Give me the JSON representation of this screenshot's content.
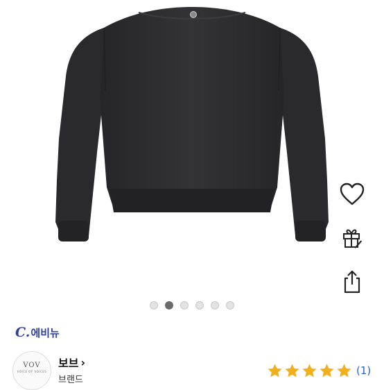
{
  "seller": {
    "logo_mark": "C.",
    "name": "에비뉴"
  },
  "brand": {
    "logo_text": "VOV",
    "logo_subtext": "VOICE OF VOICES",
    "name": "보브",
    "chevron": "›",
    "caption": "브랜드"
  },
  "rating": {
    "stars": 5,
    "max_stars": 5,
    "count_text": "(1)",
    "star_color": "#f2b01e"
  },
  "carousel": {
    "total": 6,
    "active_index": 1
  },
  "actions": {
    "icons": [
      "heart-icon",
      "gift-icon",
      "share-icon"
    ]
  },
  "colors": {
    "sweater": "#2b2b2d",
    "seller_accent": "#2c3f9e",
    "link_blue": "#2a63d4"
  }
}
